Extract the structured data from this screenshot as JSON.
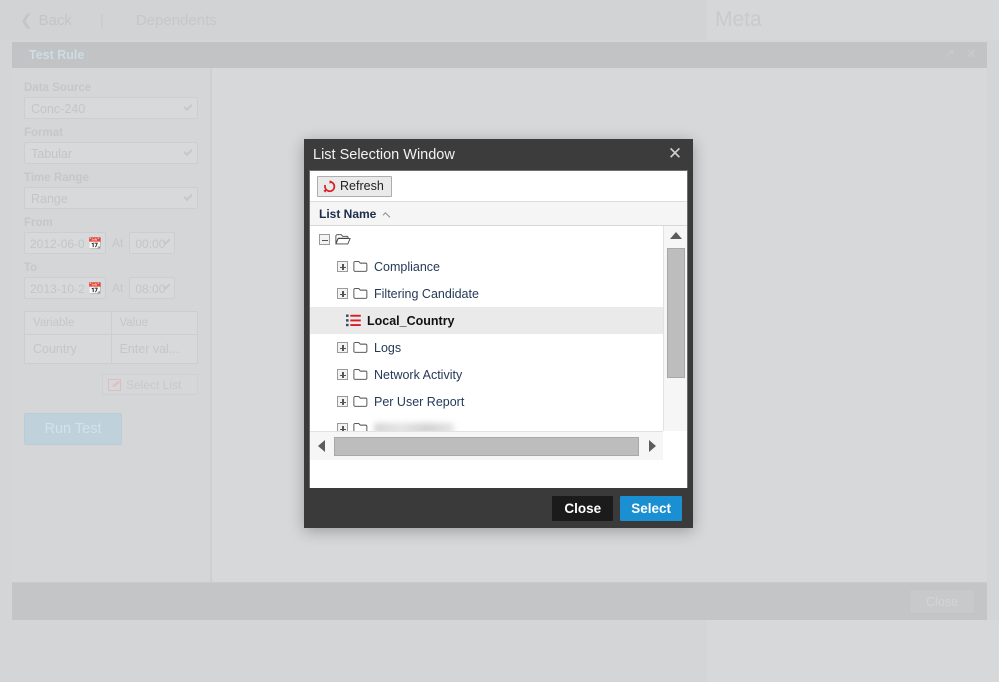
{
  "topbar": {
    "back_label": "Back",
    "separator": "|",
    "dependents_label": "Dependents",
    "meta_tab_label": "Meta"
  },
  "panel": {
    "title": "Test Rule",
    "expand_icon": "expand-icon",
    "close_icon": "close-icon",
    "footer_close_label": "Close"
  },
  "sidebar": {
    "data_source": {
      "label": "Data Source",
      "value": "Conc-240"
    },
    "format": {
      "label": "Format",
      "value": "Tabular"
    },
    "time_range": {
      "label": "Time Range",
      "value": "Range"
    },
    "from": {
      "label": "From",
      "date": "2012-06-0",
      "at_label": "At",
      "time": "00:00"
    },
    "to": {
      "label": "To",
      "date": "2013-10-2",
      "at_label": "At",
      "time": "08:00"
    },
    "variables_table": {
      "headers": [
        "Variable",
        "Value"
      ],
      "rows": [
        [
          "Country",
          "Enter val..."
        ]
      ]
    },
    "select_list_label": "Select List",
    "run_test_label": "Run Test"
  },
  "dialog": {
    "title": "List Selection Window",
    "close_icon": "close-icon",
    "refresh_label": "Refresh",
    "refresh_icon": "refresh-icon",
    "column_header": "List Name",
    "sort_direction": "asc",
    "tree": [
      {
        "label": "",
        "type": "root-folder",
        "expander": "minus",
        "indent": 0,
        "selected": false,
        "redacted": false
      },
      {
        "label": "Compliance",
        "type": "folder",
        "expander": "plus",
        "indent": 1,
        "selected": false,
        "redacted": false
      },
      {
        "label": "Filtering Candidate",
        "type": "folder",
        "expander": "plus",
        "indent": 1,
        "selected": false,
        "redacted": false
      },
      {
        "label": "Local_Country",
        "type": "list",
        "expander": "none",
        "indent": 2,
        "selected": true,
        "redacted": false
      },
      {
        "label": "Logs",
        "type": "folder",
        "expander": "plus",
        "indent": 1,
        "selected": false,
        "redacted": false
      },
      {
        "label": "Network Activity",
        "type": "folder",
        "expander": "plus",
        "indent": 1,
        "selected": false,
        "redacted": false
      },
      {
        "label": "Per User Report",
        "type": "folder",
        "expander": "plus",
        "indent": 1,
        "selected": false,
        "redacted": false
      },
      {
        "label": "",
        "type": "folder",
        "expander": "plus",
        "indent": 1,
        "selected": false,
        "redacted": true
      }
    ],
    "buttons": {
      "close_label": "Close",
      "select_label": "Select"
    }
  },
  "colors": {
    "accent_blue": "#1a8fd1",
    "dialog_chrome": "#3a3a3a",
    "selection_row": "#eaeaea",
    "refresh_red": "#d81f26",
    "page_bg": "#d4d5d6"
  }
}
